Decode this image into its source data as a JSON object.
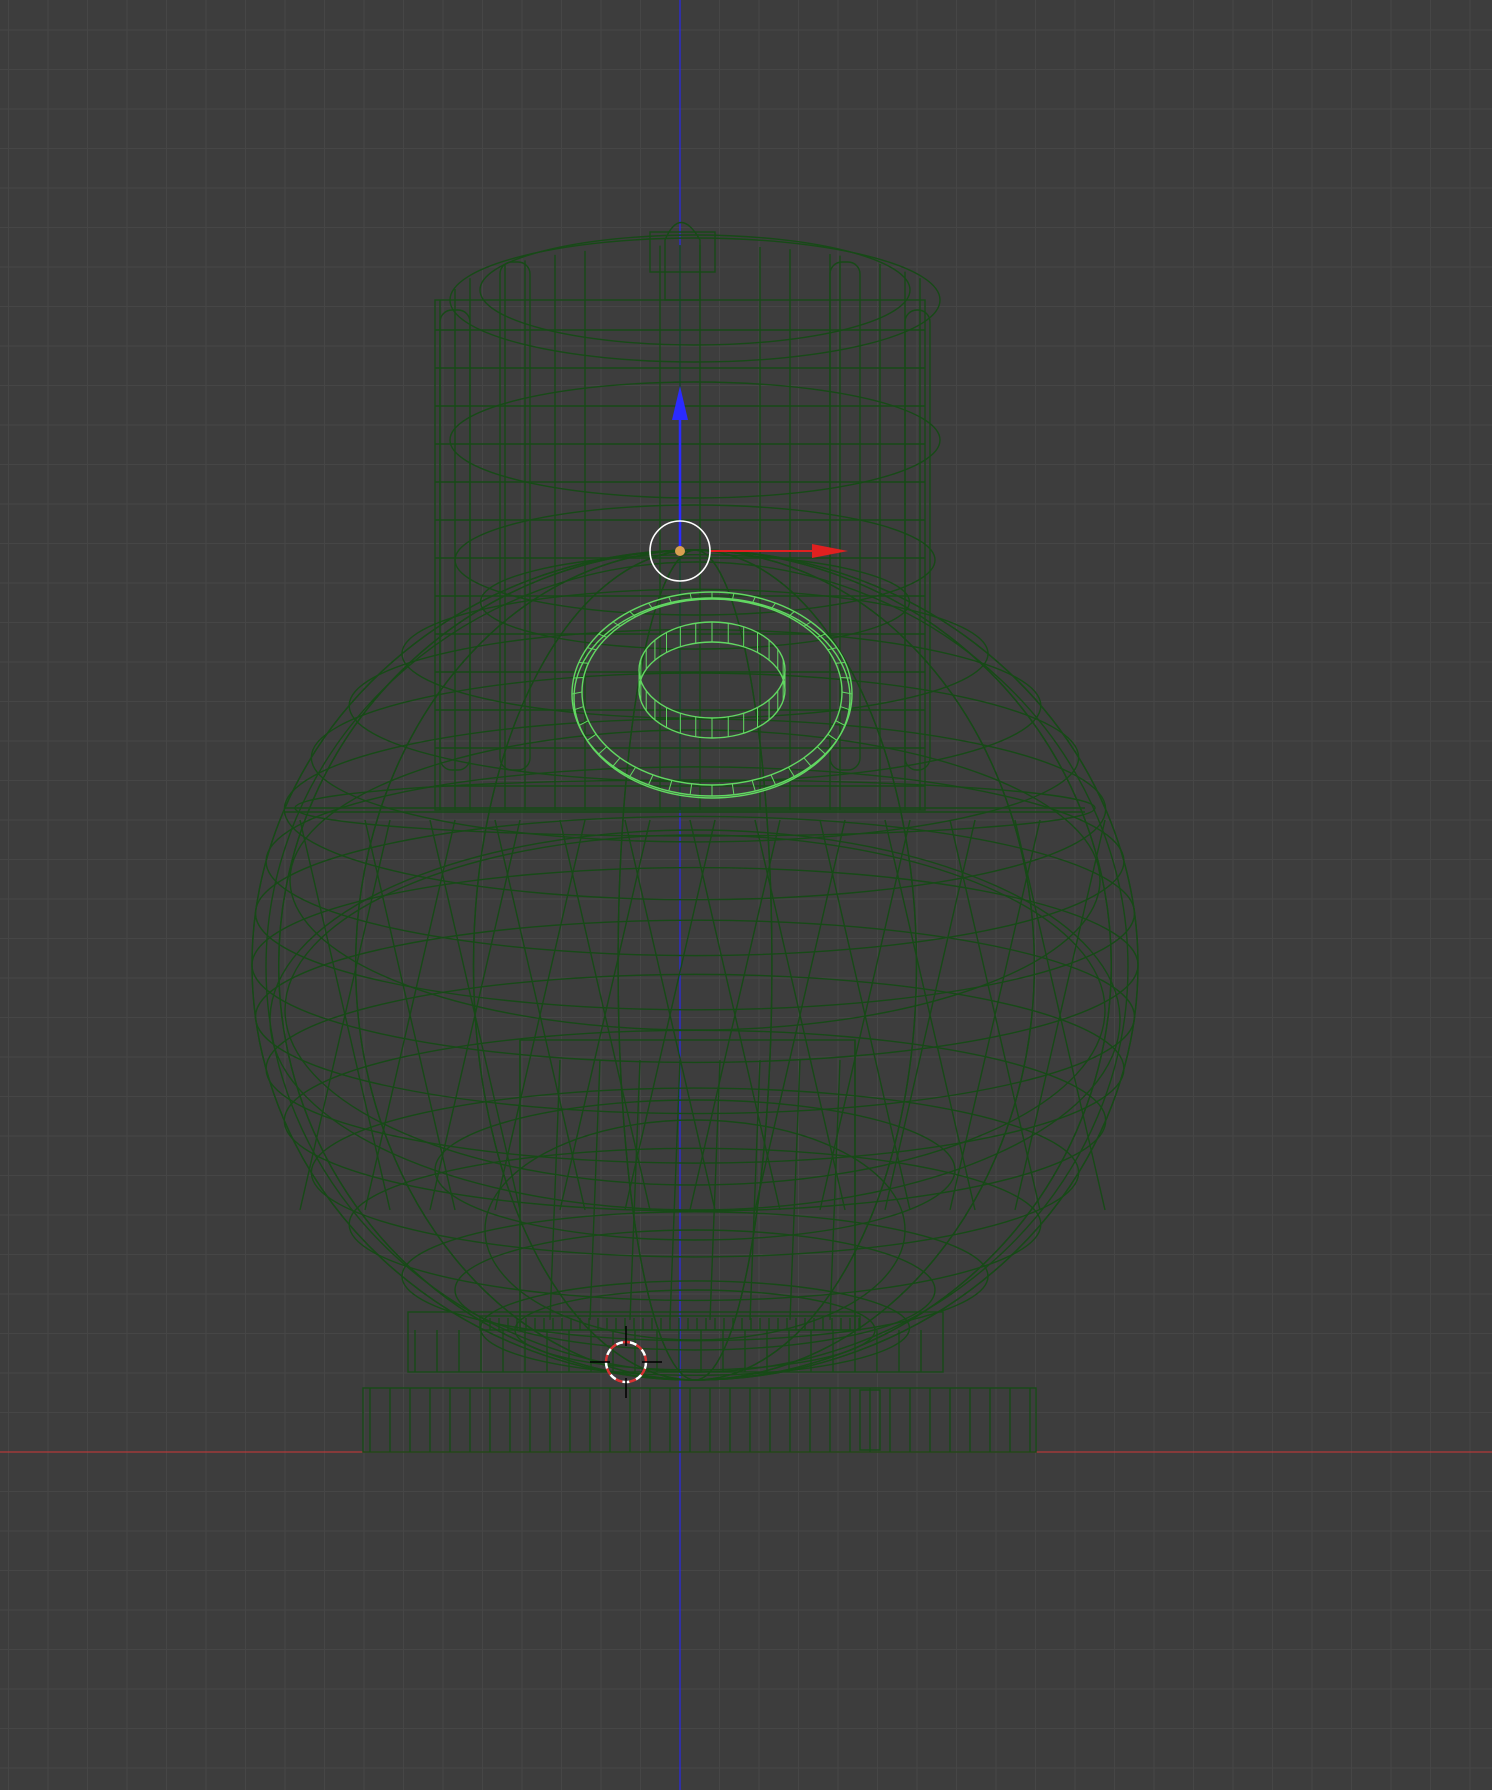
{
  "viewport": {
    "background_color": "#3d3d3d",
    "grid_color": "#474747",
    "x_axis_color": "#b23a3a",
    "z_axis_color": "#2a2ae0",
    "wireframe_color": "#174a17",
    "selected_color": "#62d862",
    "origin_dot_color": "#d9a050",
    "cursor_colors": [
      "#d83232",
      "#ffffff"
    ]
  },
  "icons": {
    "transform_gizmo": "transform-gizmo-icon",
    "object_origin": "origin-dot-icon",
    "cursor_3d": "3d-cursor-icon"
  }
}
